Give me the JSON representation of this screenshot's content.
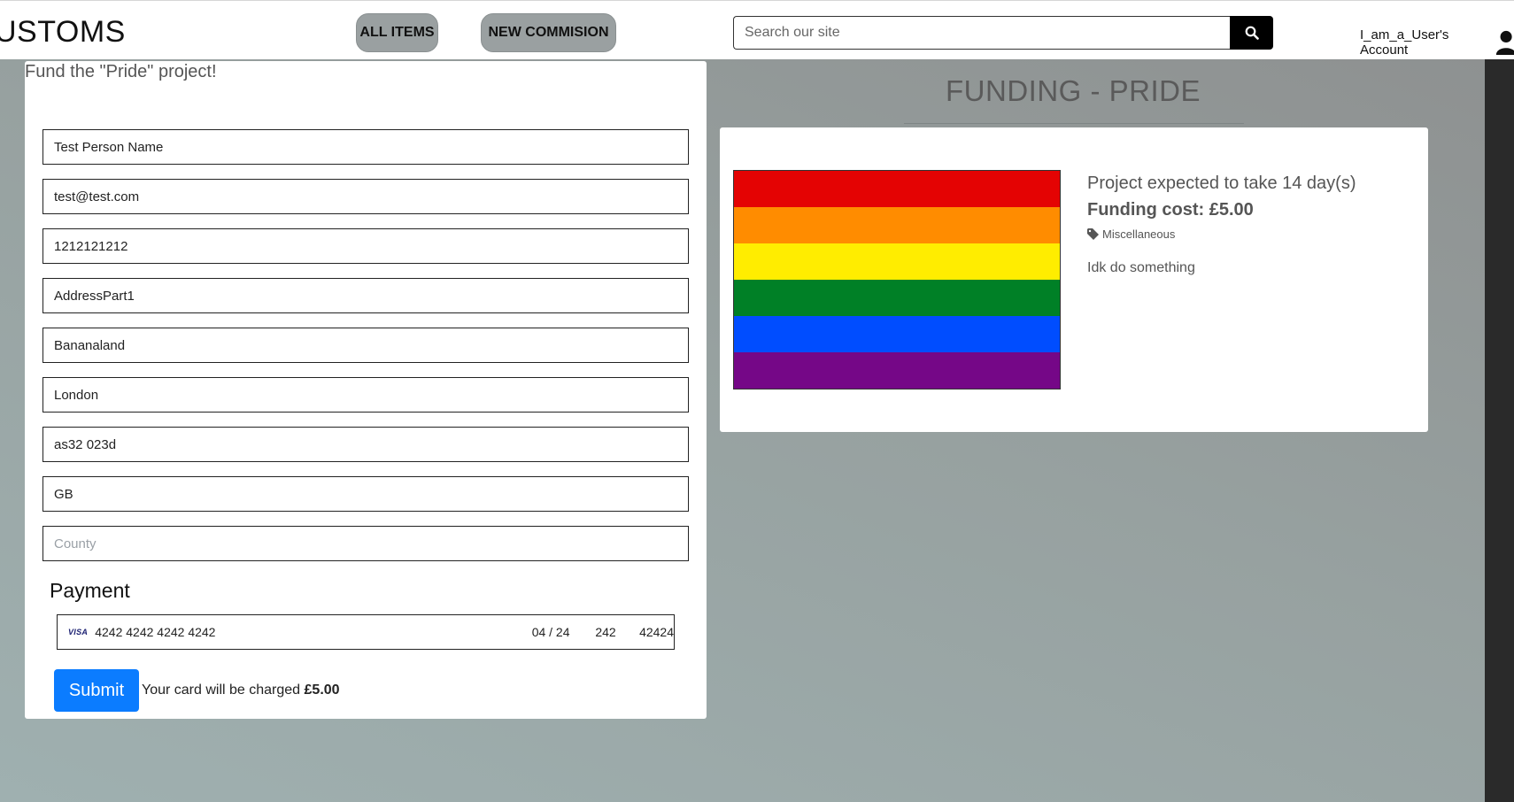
{
  "header": {
    "brand": "USTOMS",
    "nav": [
      "ALL ITEMS",
      "NEW COMMISION"
    ],
    "search_placeholder": "Search our site",
    "account_label": "I_am_a_User's Account"
  },
  "form": {
    "title": "Fund the \"Pride\" project!",
    "fields": [
      {
        "value": "Test Person Name",
        "placeholder": ""
      },
      {
        "value": "test@test.com",
        "placeholder": ""
      },
      {
        "value": "1212121212",
        "placeholder": ""
      },
      {
        "value": "AddressPart1",
        "placeholder": ""
      },
      {
        "value": "Bananaland",
        "placeholder": ""
      },
      {
        "value": "London",
        "placeholder": ""
      },
      {
        "value": "as32 023d",
        "placeholder": ""
      },
      {
        "value": "GB",
        "placeholder": ""
      },
      {
        "value": "",
        "placeholder": "County"
      }
    ],
    "payment_label": "Payment",
    "card": {
      "brand": "VISA",
      "number": "4242 4242 4242 4242",
      "expiry": "04 / 24",
      "cvc": "242",
      "postal": "42424"
    },
    "submit_label": "Submit",
    "charge_text": "Your card will be charged ",
    "charge_amount": "£5.00"
  },
  "project": {
    "heading": "FUNDING - PRIDE",
    "duration": "Project expected to take 14 day(s)",
    "cost": "Funding cost: £5.00",
    "category": "Miscellaneous",
    "description": "Idk do something",
    "flag_colors": [
      "#e40303",
      "#ff8c00",
      "#ffed00",
      "#008026",
      "#004dff",
      "#750787"
    ]
  },
  "colors": {
    "nav_button": "#9aa0a1",
    "submit": "#0b7cff",
    "search_button": "#000000"
  }
}
